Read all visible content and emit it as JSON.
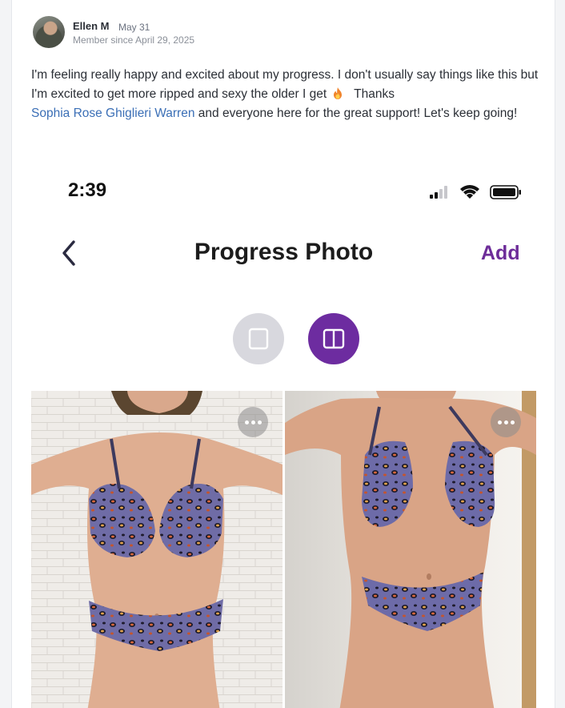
{
  "post": {
    "author": "Ellen M",
    "date": "May 31",
    "member_since": "Member since April 29, 2025",
    "body_part1": "I'm feeling really happy and excited about my progress. I don't usually say things like this but I'm excited to get more ripped and sexy the older I get",
    "body_part2": "Thanks",
    "mention": "Sophia Rose Ghiglieri Warren",
    "body_part3": "and everyone here for the great support! Let's keep going!",
    "emoji": "fire-emoji"
  },
  "screenshot": {
    "status_time": "2:39",
    "status_icons": [
      "signal-icon",
      "wifi-icon",
      "battery-icon"
    ],
    "nav_back_icon": "chevron-left-icon",
    "nav_title": "Progress Photo",
    "nav_action": "Add",
    "view_modes": [
      {
        "name": "single-view",
        "icon": "single-frame-icon",
        "selected": false
      },
      {
        "name": "split-view",
        "icon": "split-frame-icon",
        "selected": true
      }
    ],
    "accent_color": "#6d2ca0",
    "photos": [
      {
        "name": "before-photo",
        "menu_icon": "more-dots-icon"
      },
      {
        "name": "after-photo",
        "menu_icon": "more-dots-icon"
      }
    ]
  }
}
